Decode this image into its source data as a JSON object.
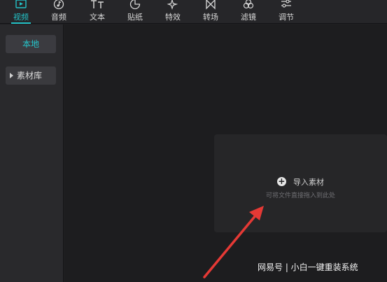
{
  "toolbar": {
    "tabs": [
      {
        "label": "视频",
        "icon": "video-icon"
      },
      {
        "label": "音频",
        "icon": "music-note-icon"
      },
      {
        "label": "文本",
        "icon": "text-icon"
      },
      {
        "label": "贴纸",
        "icon": "sticker-icon"
      },
      {
        "label": "特效",
        "icon": "sparkle-icon"
      },
      {
        "label": "转场",
        "icon": "transition-icon"
      },
      {
        "label": "滤镜",
        "icon": "filter-icon"
      },
      {
        "label": "调节",
        "icon": "adjust-sliders-icon"
      }
    ],
    "active_tab": "视频"
  },
  "sidebar": {
    "local_label": "本地",
    "library_label": "素材库"
  },
  "dropzone": {
    "import_label": "导入素材",
    "hint": "可将文件直接拖入到此处"
  },
  "watermark": "网易号 | 小白一键重装系统",
  "colors": {
    "accent": "#23c2c7",
    "arrow": "#e53935",
    "background": "#1d1d1f"
  }
}
